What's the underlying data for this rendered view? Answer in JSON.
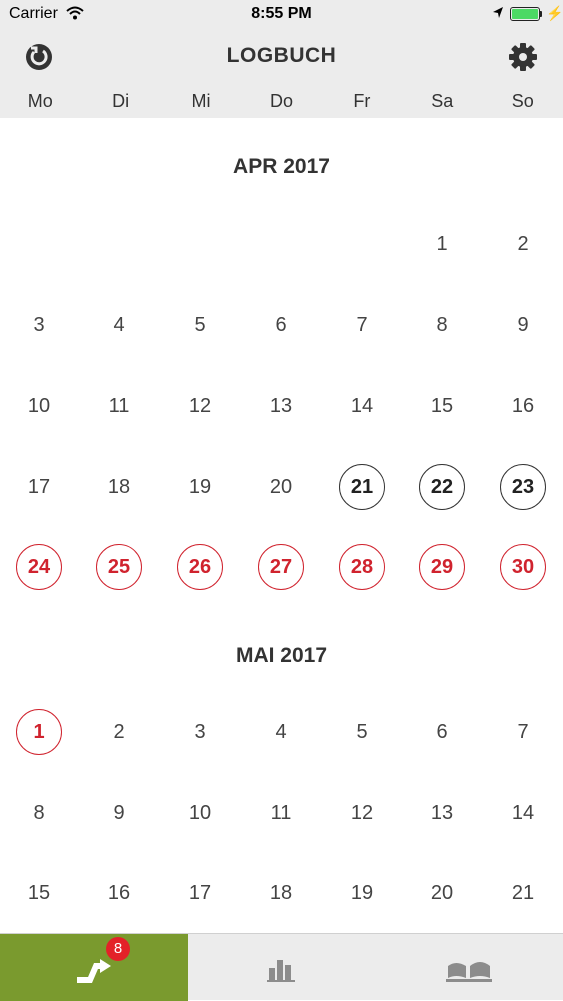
{
  "status_bar": {
    "carrier": "Carrier",
    "time": "8:55 PM"
  },
  "header": {
    "title": "LOGBUCH",
    "left_icon": "refresh-icon",
    "right_icon": "gear-icon"
  },
  "weekdays": [
    "Mo",
    "Di",
    "Mi",
    "Do",
    "Fr",
    "Sa",
    "So"
  ],
  "months": [
    {
      "title": "APR 2017",
      "weeks": [
        [
          {
            "d": ""
          },
          {
            "d": ""
          },
          {
            "d": ""
          },
          {
            "d": ""
          },
          {
            "d": ""
          },
          {
            "d": "1"
          },
          {
            "d": "2"
          }
        ],
        [
          {
            "d": "3"
          },
          {
            "d": "4"
          },
          {
            "d": "5"
          },
          {
            "d": "6"
          },
          {
            "d": "7"
          },
          {
            "d": "8"
          },
          {
            "d": "9"
          }
        ],
        [
          {
            "d": "10"
          },
          {
            "d": "11"
          },
          {
            "d": "12"
          },
          {
            "d": "13"
          },
          {
            "d": "14"
          },
          {
            "d": "15"
          },
          {
            "d": "16"
          }
        ],
        [
          {
            "d": "17"
          },
          {
            "d": "18"
          },
          {
            "d": "19"
          },
          {
            "d": "20"
          },
          {
            "d": "21",
            "s": "dark"
          },
          {
            "d": "22",
            "s": "dark"
          },
          {
            "d": "23",
            "s": "dark"
          }
        ],
        [
          {
            "d": "24",
            "s": "red"
          },
          {
            "d": "25",
            "s": "red"
          },
          {
            "d": "26",
            "s": "red"
          },
          {
            "d": "27",
            "s": "red"
          },
          {
            "d": "28",
            "s": "red"
          },
          {
            "d": "29",
            "s": "red"
          },
          {
            "d": "30",
            "s": "red"
          }
        ]
      ]
    },
    {
      "title": "MAI 2017",
      "weeks": [
        [
          {
            "d": "1",
            "s": "red"
          },
          {
            "d": "2"
          },
          {
            "d": "3"
          },
          {
            "d": "4"
          },
          {
            "d": "5"
          },
          {
            "d": "6"
          },
          {
            "d": "7"
          }
        ],
        [
          {
            "d": "8"
          },
          {
            "d": "9"
          },
          {
            "d": "10"
          },
          {
            "d": "11"
          },
          {
            "d": "12"
          },
          {
            "d": "13"
          },
          {
            "d": "14"
          }
        ],
        [
          {
            "d": "15"
          },
          {
            "d": "16"
          },
          {
            "d": "17"
          },
          {
            "d": "18"
          },
          {
            "d": "19"
          },
          {
            "d": "20"
          },
          {
            "d": "21"
          }
        ]
      ]
    }
  ],
  "tabs": [
    {
      "icon": "trips-arrow-icon",
      "badge": "8",
      "active": true
    },
    {
      "icon": "bar-chart-icon",
      "active": false
    },
    {
      "icon": "community-icon",
      "active": false
    }
  ],
  "colors": {
    "accent_green": "#7a9a2e",
    "highlight_red": "#d0232e",
    "badge_red": "#e32228"
  }
}
